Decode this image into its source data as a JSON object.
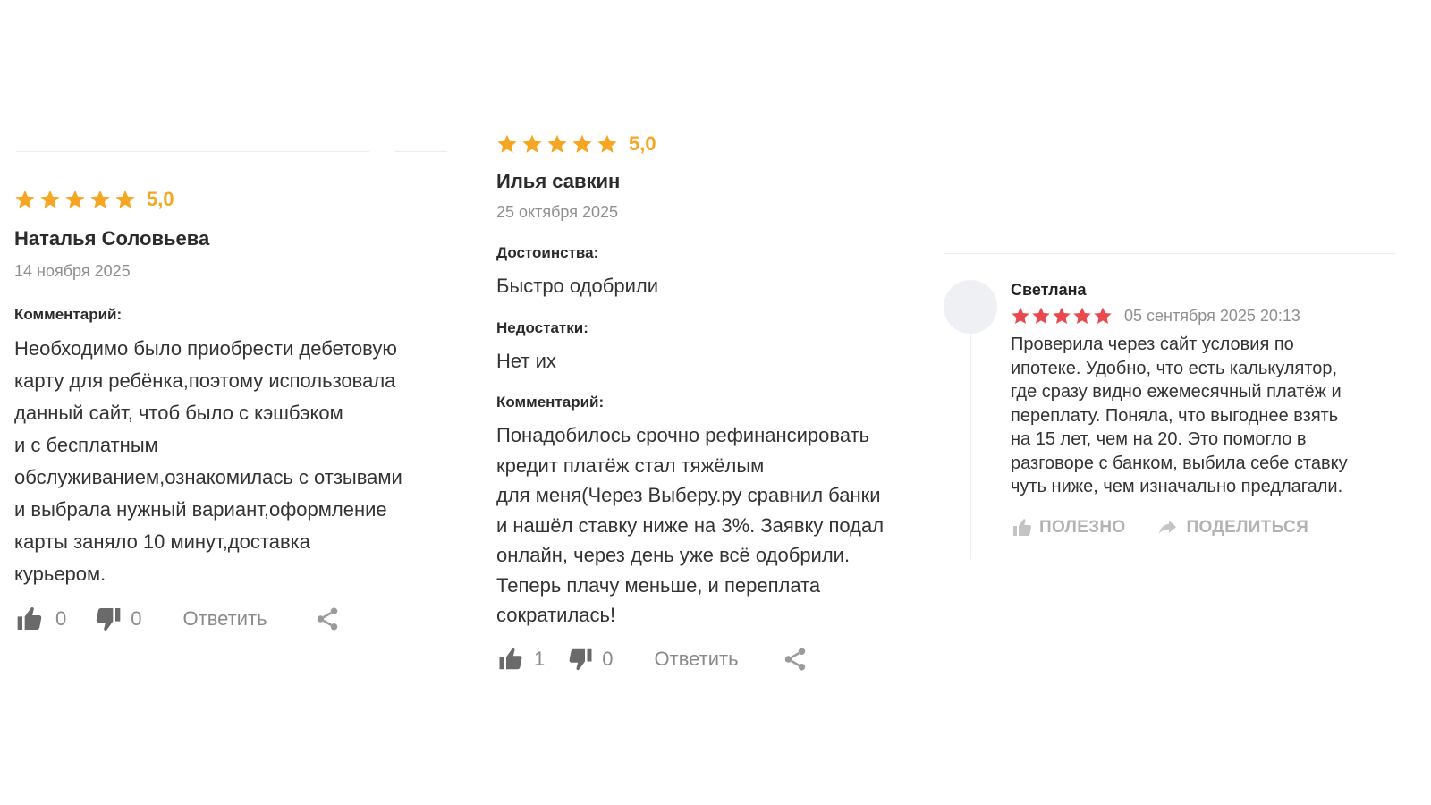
{
  "colors": {
    "star_orange": "#f6a623",
    "star_red": "#e9484e",
    "muted": "#8f8f8f"
  },
  "reviews": [
    {
      "rating": 5,
      "rating_label": "5,0",
      "author": "Наталья Соловьева",
      "date": "14 ноября 2025",
      "comment_label": "Комментарий:",
      "comment_lines": [
        "Необходимо было приобрести дебетовую",
        "карту для ребёнка,поэтому использовала",
        "данный сайт, чтоб было с кэшбэком",
        "и с бесплатным",
        "обслуживанием,ознакомилась с отзывами",
        "и выбрала нужный вариант,оформление",
        "карты заняло 10 минут,доставка",
        "курьером."
      ],
      "likes": "0",
      "dislikes": "0",
      "reply_label": "Ответить",
      "icons": [
        "thumbs-up-icon",
        "thumbs-down-icon",
        "share-icon"
      ]
    },
    {
      "rating": 5,
      "rating_label": "5,0",
      "author": "Илья савкин",
      "date": "25 октября 2025",
      "pros_label": "Достоинства:",
      "pros": "Быстро одобрили",
      "cons_label": "Недостатки:",
      "cons": "Нет их",
      "comment_label": "Комментарий:",
      "comment_lines": [
        "Понадобилось срочно рефинансировать",
        "кредит платёж стал тяжёлым",
        "для меня(Через Выберу.ру сравнил банки",
        "и нашёл ставку ниже на 3%. Заявку подал",
        "онлайн, через день уже всё одобрили.",
        "Теперь плачу меньше, и переплата",
        "сократилась!"
      ],
      "likes": "1",
      "dislikes": "0",
      "reply_label": "Ответить",
      "icons": [
        "thumbs-up-icon",
        "thumbs-down-icon",
        "share-icon"
      ]
    },
    {
      "rating": 5,
      "author": "Светлана",
      "date": "05 сентября 2025 20:13",
      "text_lines": [
        "Проверила через сайт условия по",
        "ипотеке. Удобно, что есть калькулятор,",
        "где сразу видно ежемесячный платёж и",
        "переплату. Поняла, что выгоднее взять",
        "на 15 лет, чем на 20. Это помогло в",
        "разговоре с банком, выбила себе ставку",
        "чуть ниже, чем изначально предлагали."
      ],
      "useful_label": "ПОЛЕЗНО",
      "share_label": "ПОДЕЛИТЬСЯ",
      "icons": [
        "avatar",
        "thumbs-up-icon",
        "share-arrow-icon"
      ]
    }
  ]
}
